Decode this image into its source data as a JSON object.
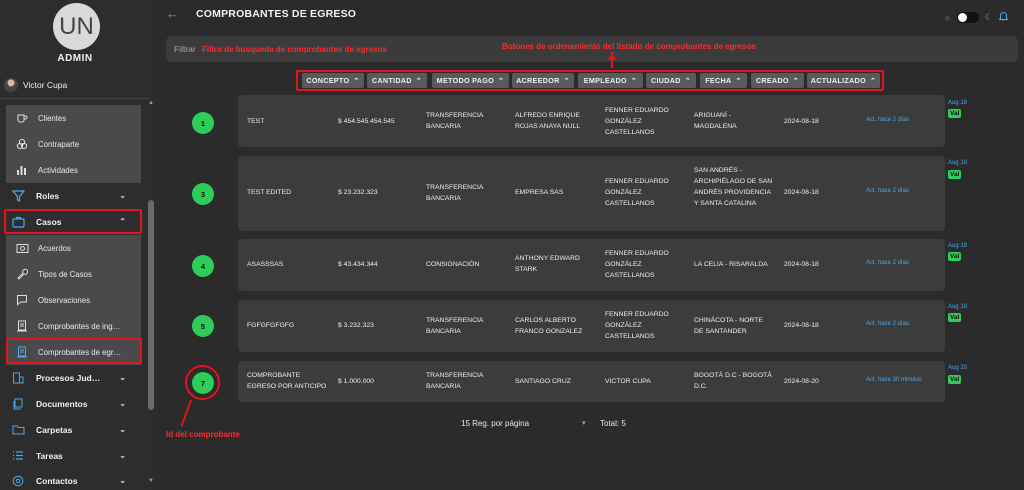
{
  "sidebar": {
    "avatar_initials": "UN",
    "role": "ADMIN",
    "user_name": "Victor Cupa",
    "sub_items_top": [
      {
        "label": "Clientes",
        "icon": "coffee-icon"
      },
      {
        "label": "Contraparte",
        "icon": "circles-icon"
      },
      {
        "label": "Actividades",
        "icon": "bar-chart-icon"
      }
    ],
    "roles": "Roles",
    "casos": "Casos",
    "casos_items": [
      {
        "label": "Acuerdos",
        "icon": "money-icon"
      },
      {
        "label": "Tipos de Casos",
        "icon": "wrench-icon"
      },
      {
        "label": "Observaciones",
        "icon": "chat-icon"
      },
      {
        "label": "Comprobantes de ing…",
        "icon": "receipt-icon"
      },
      {
        "label": "Comprobantes de egr…",
        "icon": "receipt-out-icon"
      }
    ],
    "bottom_items": [
      {
        "label": "Procesos Jud…",
        "icon": "building-icon"
      },
      {
        "label": "Documentos",
        "icon": "documents-icon"
      },
      {
        "label": "Carpetas",
        "icon": "folder-icon"
      },
      {
        "label": "Tareas",
        "icon": "list-icon"
      },
      {
        "label": "Contactos",
        "icon": "at-icon"
      }
    ]
  },
  "header": {
    "title": "COMPROBANTES DE EGRESO"
  },
  "filter": {
    "label": "Filtrar"
  },
  "annotations": {
    "filter": "Filtro de busqueda de comprobantes de egresos",
    "sort": "Botones de ordenamiento del listado de comprobantes de egresos",
    "id": "Id del comprobante"
  },
  "sort_buttons": [
    "CONCEPTO",
    "CANTIDAD",
    "METODO PAGO",
    "ACREEDOR",
    "EMPLEADO",
    "CIUDAD",
    "FECHA",
    "CREADO",
    "ACTUALIZADO"
  ],
  "rows": [
    {
      "id": "1",
      "concepto": "TEST",
      "cantidad": "$ 454.545.454.545",
      "metodo": "TRANSFERENCIA BANCARIA",
      "acreedor": "ALFREDO ENRIQUE ROJAS ANAYA NULL",
      "empleado": "FENNER EDUARDO GONZÁLEZ CASTELLANOS",
      "ciudad": "ARIGUANÍ - MAGDALENA",
      "fecha": "2024-08-18",
      "actualizado": "Act. hace 2 días",
      "creado": "Aug 18",
      "badge": "Val"
    },
    {
      "id": "3",
      "concepto": "TEST EDITED",
      "cantidad": "$ 23.232.323",
      "metodo": "TRANSFERENCIA BANCARIA",
      "acreedor": "EMPRESA SAS",
      "empleado": "FENNER EDUARDO GONZÁLEZ CASTELLANOS",
      "ciudad": "SAN ANDRÉS - ARCHIPIÉLAGO DE SAN ANDRÉS PROVIDENCIA Y SANTA CATALINA",
      "fecha": "2024-08-18",
      "actualizado": "Act. hace 2 días",
      "creado": "Aug 18",
      "badge": "Val"
    },
    {
      "id": "4",
      "concepto": "ASASSSAS",
      "cantidad": "$ 43.434.344",
      "metodo": "CONSIGNACIÓN",
      "acreedor": "ANTHONY EDWARD STARK",
      "empleado": "FENNER EDUARDO GONZÁLEZ CASTELLANOS",
      "ciudad": "LA CELIA - RISARALDA",
      "fecha": "2024-08-18",
      "actualizado": "Act. hace 2 días",
      "creado": "Aug 18",
      "badge": "Val"
    },
    {
      "id": "5",
      "concepto": "FGFGFGFGFG",
      "cantidad": "$ 3.232.323",
      "metodo": "TRANSFERENCIA BANCARIA",
      "acreedor": "CARLOS ALBERTO FRANCO GONZALEZ",
      "empleado": "FENNER EDUARDO GONZÁLEZ CASTELLANOS",
      "ciudad": "CHINÁCOTA - NORTE DE SANTANDER",
      "fecha": "2024-08-18",
      "actualizado": "Act. hace 2 días",
      "creado": "Aug 18",
      "badge": "Val"
    },
    {
      "id": "7",
      "concepto": "COMPROBANTE EGRESO POR ANTICIPO",
      "cantidad": "$ 1.000.000",
      "metodo": "TRANSFERENCIA BANCARIA",
      "acreedor": "SANTIAGO CRUZ",
      "empleado": "VICTOR CUPA",
      "ciudad": "BOGOTÁ D.C - BOGOTÁ D.C.",
      "fecha": "2024-08-20",
      "actualizado": "Act. hace 30 minutos",
      "creado": "Aug 20",
      "badge": "Val"
    }
  ],
  "pagination": {
    "per_page": "15 Reg. por página",
    "total": "Total: 5"
  },
  "colors": {
    "accent_green": "#2ecc59",
    "link_blue": "#4aa8e8",
    "highlight_red": "#e3141b"
  }
}
